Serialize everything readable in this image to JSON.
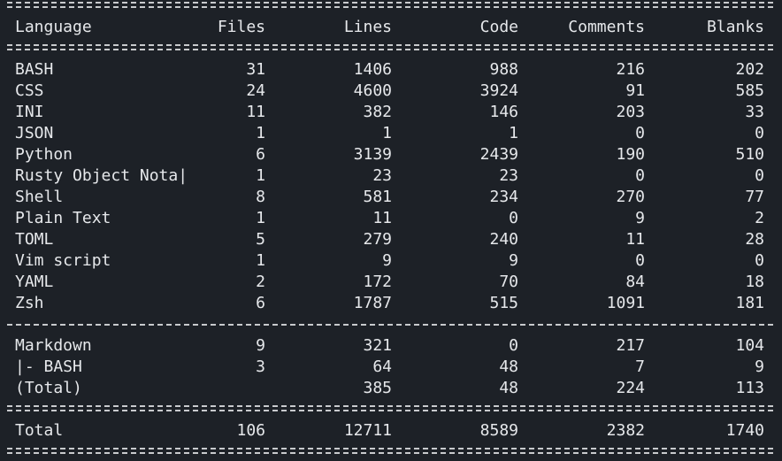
{
  "header": {
    "language": "Language",
    "files": "Files",
    "lines": "Lines",
    "code": "Code",
    "comments": "Comments",
    "blanks": "Blanks"
  },
  "rows": [
    {
      "language": "BASH",
      "files": "31",
      "lines": "1406",
      "code": "988",
      "comments": "216",
      "blanks": "202"
    },
    {
      "language": "CSS",
      "files": "24",
      "lines": "4600",
      "code": "3924",
      "comments": "91",
      "blanks": "585"
    },
    {
      "language": "INI",
      "files": "11",
      "lines": "382",
      "code": "146",
      "comments": "203",
      "blanks": "33"
    },
    {
      "language": "JSON",
      "files": "1",
      "lines": "1",
      "code": "1",
      "comments": "0",
      "blanks": "0"
    },
    {
      "language": "Python",
      "files": "6",
      "lines": "3139",
      "code": "2439",
      "comments": "190",
      "blanks": "510"
    },
    {
      "language": "Rusty Object Nota|",
      "files": "1",
      "lines": "23",
      "code": "23",
      "comments": "0",
      "blanks": "0"
    },
    {
      "language": "Shell",
      "files": "8",
      "lines": "581",
      "code": "234",
      "comments": "270",
      "blanks": "77"
    },
    {
      "language": "Plain Text",
      "files": "1",
      "lines": "11",
      "code": "0",
      "comments": "9",
      "blanks": "2"
    },
    {
      "language": "TOML",
      "files": "5",
      "lines": "279",
      "code": "240",
      "comments": "11",
      "blanks": "28"
    },
    {
      "language": "Vim script",
      "files": "1",
      "lines": "9",
      "code": "9",
      "comments": "0",
      "blanks": "0"
    },
    {
      "language": "YAML",
      "files": "2",
      "lines": "172",
      "code": "70",
      "comments": "84",
      "blanks": "18"
    },
    {
      "language": "Zsh",
      "files": "6",
      "lines": "1787",
      "code": "515",
      "comments": "1091",
      "blanks": "181"
    }
  ],
  "markdown_rows": [
    {
      "language": "Markdown",
      "files": "9",
      "lines": "321",
      "code": "0",
      "comments": "217",
      "blanks": "104"
    },
    {
      "language": "|- BASH",
      "files": "3",
      "lines": "64",
      "code": "48",
      "comments": "7",
      "blanks": "9"
    },
    {
      "language": "(Total)",
      "files": "",
      "lines": "385",
      "code": "48",
      "comments": "224",
      "blanks": "113"
    }
  ],
  "total": {
    "language": "Total",
    "files": "106",
    "lines": "12711",
    "code": "8589",
    "comments": "2382",
    "blanks": "1740"
  }
}
